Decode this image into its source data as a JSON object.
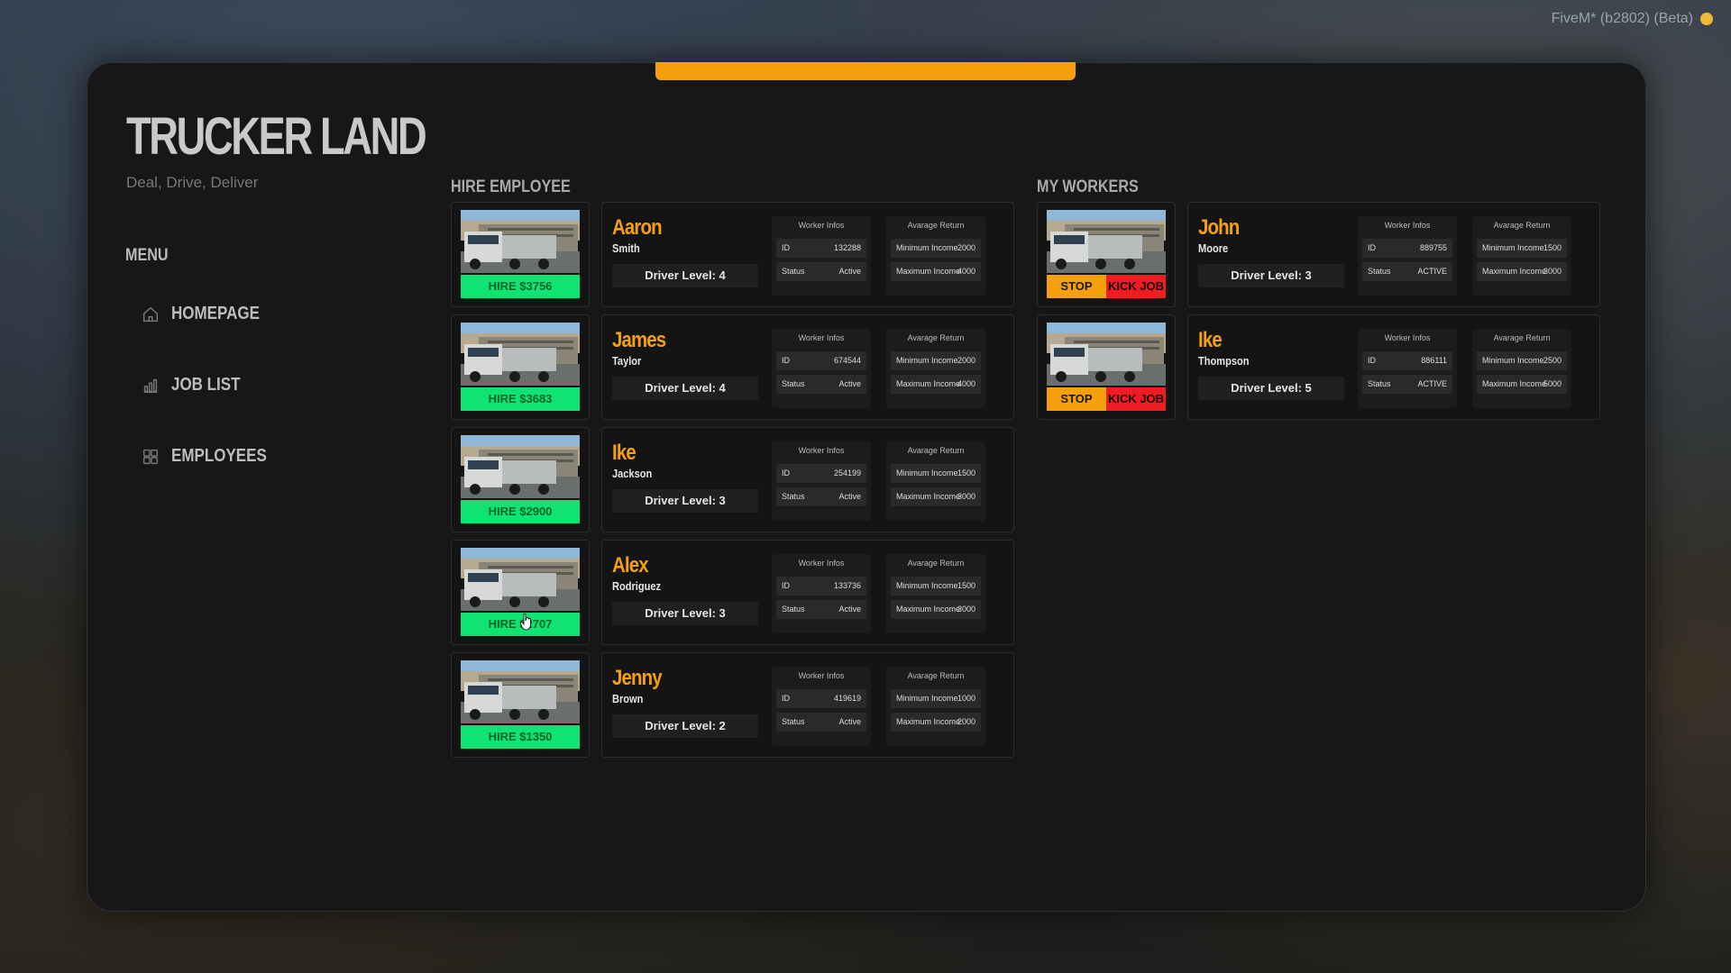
{
  "overlay": {
    "text": "FiveM* (b2802) (Beta)"
  },
  "brand": {
    "title": "TRUCKER LAND",
    "subtitle": "Deal, Drive, Deliver"
  },
  "menu": {
    "title": "MENU",
    "items": [
      {
        "label": "HOMEPAGE",
        "icon": "home-icon"
      },
      {
        "label": "JOB LIST",
        "icon": "bar-chart-icon"
      },
      {
        "label": "EMPLOYEES",
        "icon": "grid-icon"
      }
    ]
  },
  "hire": {
    "title": "HIRE EMPLOYEE",
    "worker_infos_label": "Worker Infos",
    "average_return_label": "Avarage Return",
    "id_label": "ID",
    "status_label": "Status",
    "min_label": "Minimum Income",
    "max_label": "Maximum Income",
    "employees": [
      {
        "hire": "HIRE $3756",
        "first": "Aaron",
        "last": "Smith",
        "level": "Driver Level: 4",
        "id": "132288",
        "status": "Active",
        "min": "2000",
        "max": "4000"
      },
      {
        "hire": "HIRE $3683",
        "first": "James",
        "last": "Taylor",
        "level": "Driver Level: 4",
        "id": "674544",
        "status": "Active",
        "min": "2000",
        "max": "4000"
      },
      {
        "hire": "HIRE $2900",
        "first": "Ike",
        "last": "Jackson",
        "level": "Driver Level: 3",
        "id": "254199",
        "status": "Active",
        "min": "1500",
        "max": "3000"
      },
      {
        "hire": "HIRE $2707",
        "first": "Alex",
        "last": "Rodriguez",
        "level": "Driver Level: 3",
        "id": "133736",
        "status": "Active",
        "min": "1500",
        "max": "3000"
      },
      {
        "hire": "HIRE $1350",
        "first": "Jenny",
        "last": "Brown",
        "level": "Driver Level: 2",
        "id": "419619",
        "status": "Active",
        "min": "1000",
        "max": "2000"
      }
    ]
  },
  "workers": {
    "title": "MY WORKERS",
    "stop_label": "STOP",
    "kick_label": "KICK JOB",
    "list": [
      {
        "first": "John",
        "last": "Moore",
        "level": "Driver Level: 3",
        "id": "889755",
        "status": "ACTIVE",
        "min": "1500",
        "max": "3000"
      },
      {
        "first": "Ike",
        "last": "Thompson",
        "level": "Driver Level: 5",
        "id": "886111",
        "status": "ACTIVE",
        "min": "2500",
        "max": "5000"
      }
    ]
  },
  "colors": {
    "accent": "#f4a10d",
    "hire": "#10e373",
    "kick": "#f01c24",
    "panel": "#171717"
  }
}
